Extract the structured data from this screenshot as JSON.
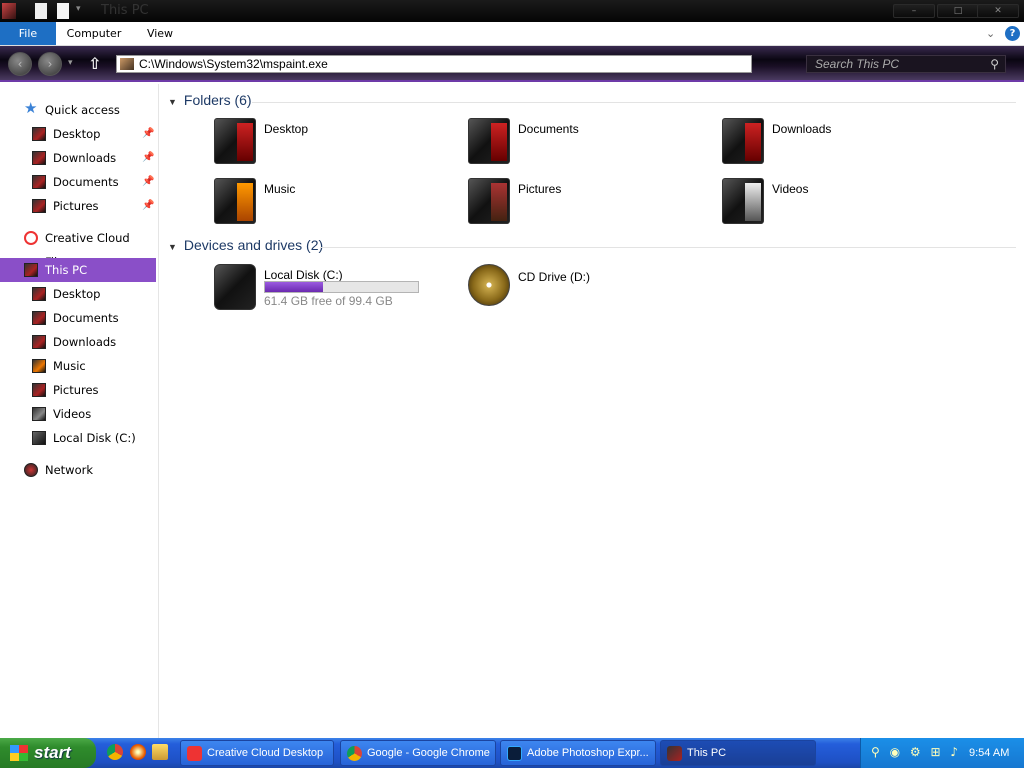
{
  "window": {
    "title": "This PC",
    "controls": {
      "minimize": "–",
      "maximize": "□",
      "close": "✕"
    }
  },
  "ribbon": {
    "tabs": [
      {
        "label": "File"
      },
      {
        "label": "Computer"
      },
      {
        "label": "View"
      }
    ],
    "help_label": "?"
  },
  "address_bar": {
    "path": "C:\\Windows\\System32\\mspaint.exe",
    "search_placeholder": "Search This PC"
  },
  "nav_pane": {
    "quick_access": {
      "label": "Quick access",
      "items": [
        {
          "label": "Desktop",
          "pinned": true
        },
        {
          "label": "Downloads",
          "pinned": true
        },
        {
          "label": "Documents",
          "pinned": true
        },
        {
          "label": "Pictures",
          "pinned": true
        }
      ]
    },
    "creative_cloud": {
      "label": "Creative Cloud Files"
    },
    "this_pc": {
      "label": "This PC",
      "selected": true,
      "items": [
        {
          "label": "Desktop"
        },
        {
          "label": "Documents"
        },
        {
          "label": "Downloads"
        },
        {
          "label": "Music"
        },
        {
          "label": "Pictures"
        },
        {
          "label": "Videos"
        },
        {
          "label": "Local Disk (C:)"
        }
      ]
    },
    "network": {
      "label": "Network"
    }
  },
  "main": {
    "folders_header": "Folders (6)",
    "folders": [
      {
        "label": "Desktop"
      },
      {
        "label": "Documents"
      },
      {
        "label": "Downloads"
      },
      {
        "label": "Music"
      },
      {
        "label": "Pictures"
      },
      {
        "label": "Videos"
      }
    ],
    "drives_header": "Devices and drives (2)",
    "drives": [
      {
        "label": "Local Disk (C:)",
        "free_text": "61.4 GB free of 99.4 GB",
        "used_fraction": 0.382
      },
      {
        "label": "CD Drive (D:)"
      }
    ]
  },
  "taskbar": {
    "start_label": "start",
    "tasks": [
      {
        "label": "Creative Cloud Desktop"
      },
      {
        "label": "Google - Google Chrome"
      },
      {
        "label": "Adobe Photoshop Expr..."
      },
      {
        "label": "This PC",
        "active": true
      }
    ],
    "clock": "9:54 AM"
  },
  "colors": {
    "accent_purple": "#8a4fc8",
    "file_tab_blue": "#1e6fc4",
    "taskbar_blue": "#245edb",
    "start_green": "#2f8c2c"
  }
}
